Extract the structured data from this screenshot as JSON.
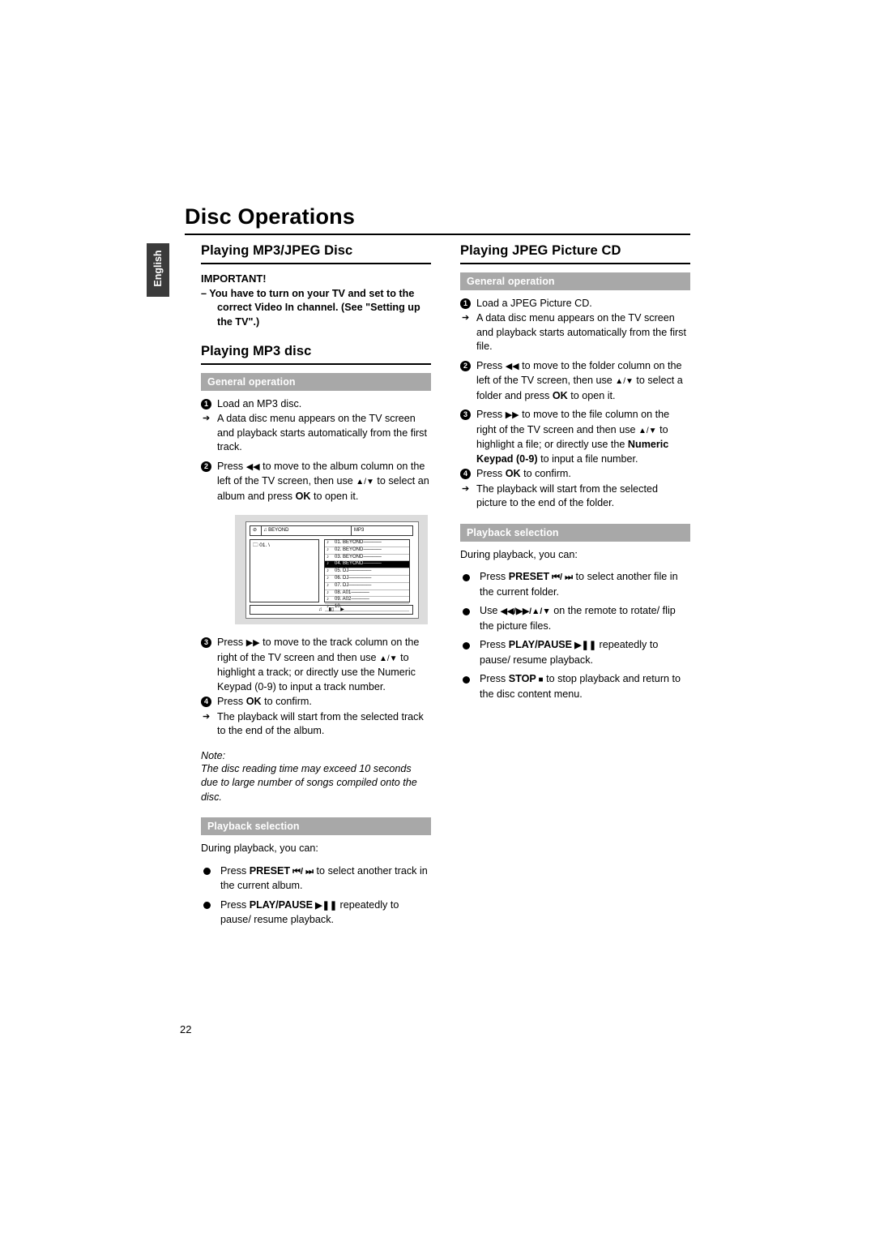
{
  "document": {
    "title": "Disc Operations",
    "language_tab": "English",
    "page_number": "22"
  },
  "left_column": {
    "section1_heading": "Playing MP3/JPEG Disc",
    "important_label": "IMPORTANT!",
    "important_text": "–   You have to turn on your TV and set to the correct Video In channel. (See \"Setting up the TV\".)",
    "section2_heading": "Playing MP3 disc",
    "general_operation_band": "General operation",
    "step1": "Load an MP3 disc.",
    "step1_note": "A data disc menu appears on the TV screen and playback starts automatically from the first track.",
    "step2_a": "Press ",
    "step2_b": " to move to the album column on the left of the TV screen, then use ",
    "step2_c": " to select an album and press ",
    "step2_ok": "OK",
    "step2_d": " to open it.",
    "step3_a": "Press ",
    "step3_b": " to move to the track column on the right of the TV screen and then use ",
    "step3_c": " to highlight a track; or directly use the Numeric Keypad (0-9) to input a track number.",
    "step4_a": "Press ",
    "step4_ok": "OK",
    "step4_b": " to confirm.",
    "step4_note": "The playback will start from the selected track to the end of the album.",
    "note_label": "Note:",
    "note_body": "The disc reading time may exceed 10 seconds due to large number of songs compiled onto the disc.",
    "playback_selection_band": "Playback selection",
    "playback_intro": "During playback, you can:",
    "bullet1_a": "Press ",
    "bullet1_bold": "PRESET",
    "bullet1_b": " to select another track in the current album.",
    "bullet2_a": "Press ",
    "bullet2_bold": "PLAY/PAUSE",
    "bullet2_b": " repeatedly to pause/ resume playback."
  },
  "figure": {
    "top_label_1": "BEYOND",
    "top_label_2": "MP3",
    "left_item": "01.  \\",
    "tracks": [
      "01.  BEYOND",
      "02.  BEYOND",
      "03.  BEYOND",
      "04.  BEYOND",
      "05.  DJ",
      "06.  DJ",
      "07.  DJ",
      "08.  A01",
      "09.  A02",
      "10."
    ],
    "highlighted_index": 3
  },
  "right_column": {
    "section1_heading": "Playing JPEG Picture CD",
    "general_operation_band": "General operation",
    "step1": "Load a JPEG Picture CD.",
    "step1_note": "A data disc menu appears on the TV screen and playback starts automatically from the first file.",
    "step2_a": "Press ",
    "step2_b": " to move to the folder column on the left of the TV screen, then use ",
    "step2_c": " to select a folder and press ",
    "step2_ok": "OK",
    "step2_d": " to open it.",
    "step3_a": "Press ",
    "step3_b": " to move to the file column on the right of the TV screen and then use ",
    "step3_c": " to highlight a file; or directly use the ",
    "step3_bold1": "Numeric Keypad (0-9)",
    "step3_d": " to input a file number.",
    "step4_a": "Press ",
    "step4_ok": "OK",
    "step4_b": " to confirm.",
    "step4_note": "The playback will start from the selected picture to the end of the folder.",
    "playback_selection_band": "Playback selection",
    "playback_intro": "During playback, you can:",
    "bullet1_a": "Press ",
    "bullet1_bold": "PRESET",
    "bullet1_b": " to select another file in the current folder.",
    "bullet2_a": "Use ",
    "bullet2_b": " on the remote to rotate/ flip the picture files.",
    "bullet3_a": "Press ",
    "bullet3_bold": "PLAY/PAUSE",
    "bullet3_b": " repeatedly to pause/ resume playback.",
    "bullet4_a": "Press ",
    "bullet4_bold": "STOP",
    "bullet4_b": " to stop playback and return to the disc content menu."
  }
}
